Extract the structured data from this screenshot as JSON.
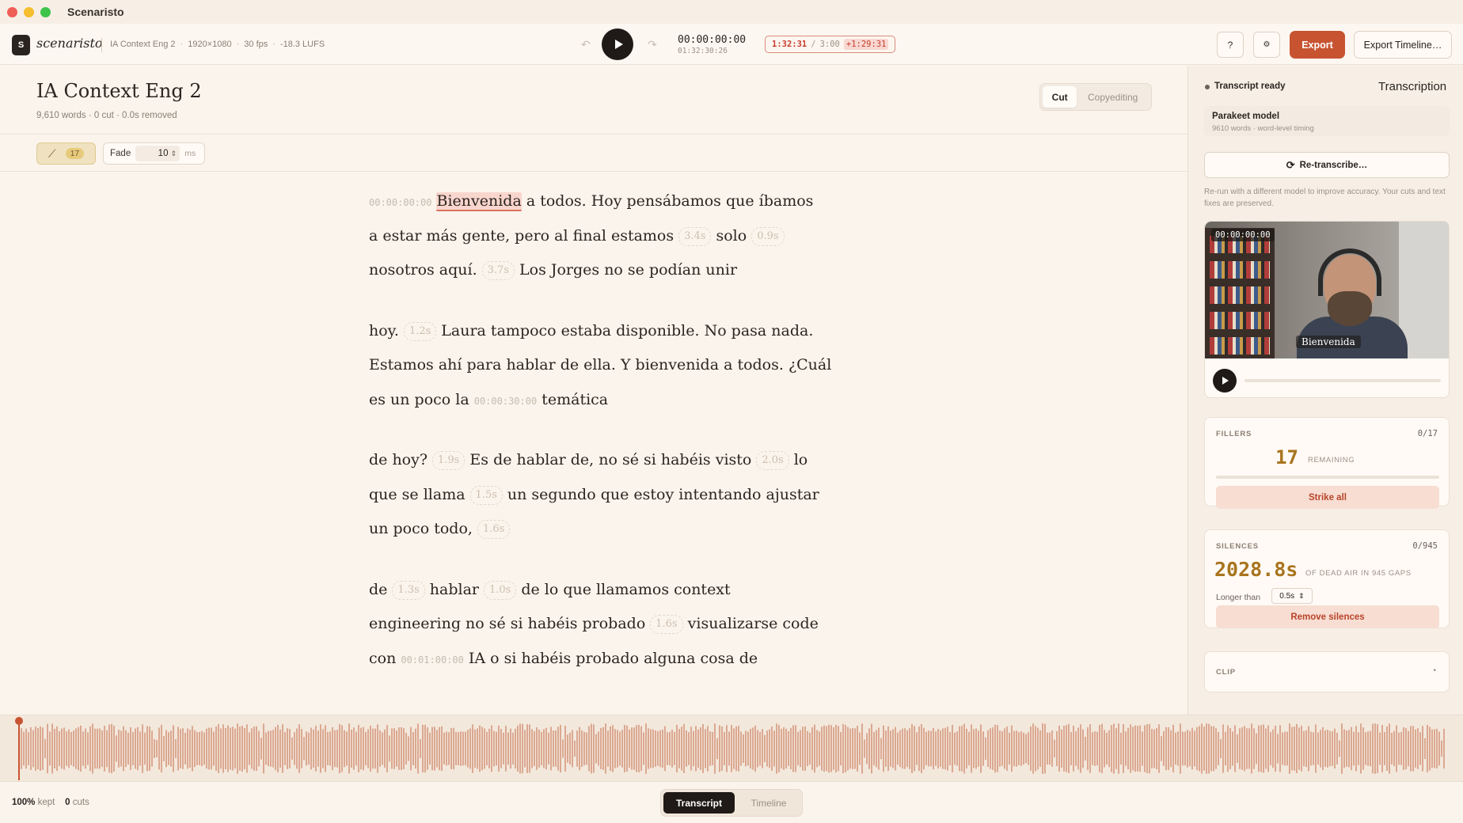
{
  "window": {
    "title": "Scenaristo"
  },
  "toolbar": {
    "logo_letter": "S",
    "logo_text": "scenaristo",
    "project": "IA Context Eng 2",
    "resolution": "1920×1080",
    "fps": "30 fps",
    "loudness": "-18.3 LUFS",
    "dot": "·",
    "timecode": "00:00:00:00",
    "timecode_total": "01:32:30:26",
    "duration_current": "1:32:31",
    "duration_slash": "/",
    "duration_target": "3:00",
    "duration_over": "+1:29:31",
    "help_label": "?",
    "settings_label": "⚙",
    "export_label": "Export",
    "export_timeline_label": "Export Timeline…"
  },
  "editor": {
    "title": "IA Context Eng 2",
    "meta": "9,610 words   ·   0 cut · 0.0s removed",
    "mode_cut": "Cut",
    "mode_copyediting": "Copyediting",
    "brush_count": "17",
    "fade_label": "Fade",
    "fade_value": "10",
    "fade_unit": "ms"
  },
  "transcript": {
    "p1": {
      "l1_tc": "00:00:00:00",
      "l1_word": "Bienvenida",
      "l1_rest": " a todos. Hoy pensábamos que íbamos",
      "l2_a": "a estar más gente, pero al final estamos",
      "l2_gap1": "3.4s",
      "l2_b": "solo",
      "l2_gap2": "0.9s",
      "l3_a": "nosotros aquí.",
      "l3_gap": "3.7s",
      "l3_b": "Los Jorges no se podían unir"
    },
    "p2": {
      "l1_a": "hoy.",
      "l1_gap": "1.2s",
      "l1_b": "Laura tampoco estaba disponible. No pasa nada.",
      "l2": "Estamos ahí para hablar de ella. Y bienvenida a todos. ¿Cuál",
      "l3_a": "es un poco la",
      "l3_tc": "00:00:30:00",
      "l3_b": "temática"
    },
    "p3": {
      "l1_a": "de hoy?",
      "l1_gap1": "1.9s",
      "l1_b": "Es de hablar de, no sé si habéis visto",
      "l1_gap2": "2.0s",
      "l1_c": "lo",
      "l2_a": "que se llama",
      "l2_gap": "1.5s",
      "l2_b": "un segundo que estoy intentando ajustar",
      "l3_a": "un poco todo,",
      "l3_gap": "1.6s"
    },
    "p4": {
      "l1_a": "de",
      "l1_gap1": "1.3s",
      "l1_b": "hablar",
      "l1_gap2": "1.0s",
      "l1_c": "de lo que llamamos context",
      "l2_a": "engineering no sé si habéis probado",
      "l2_gap": "1.6s",
      "l2_b": "visualizarse code",
      "l3_a": "con",
      "l3_tc": "00:01:00:00",
      "l3_b": "IA o si habéis probado alguna cosa de"
    }
  },
  "panel": {
    "status": "Transcript ready",
    "title": "Transcription",
    "model_name": "Parakeet model",
    "model_sub": "9610 words · word-level timing",
    "retranscribe_label": "Re-transcribe…",
    "retranscribe_note": "Re-run with a different model to improve accuracy. Your cuts and text fixes are preserved.",
    "video_timecode": "00:00:00:00",
    "video_caption": "Bienvenida",
    "fillers": {
      "label": "FILLERS",
      "count": "0/17",
      "number": "17",
      "unit": "REMAINING",
      "action": "Strike all"
    },
    "silences": {
      "label": "SILENCES",
      "count": "0/945",
      "number": "2028.8s",
      "unit": "OF DEAD AIR IN 945 GAPS",
      "longer_label": "Longer than",
      "longer_value": "0.5s",
      "action": "Remove silences"
    },
    "clip": {
      "label": "CLIP",
      "toggle": "•"
    }
  },
  "bottom": {
    "kept_pct": "100%",
    "kept_label": "kept",
    "cuts_num": "0",
    "cuts_label": "cuts",
    "view_transcript": "Transcript",
    "view_timeline": "Timeline"
  },
  "colors": {
    "accent": "#c75331",
    "gold": "#a8741e",
    "wave": "#dba891"
  }
}
